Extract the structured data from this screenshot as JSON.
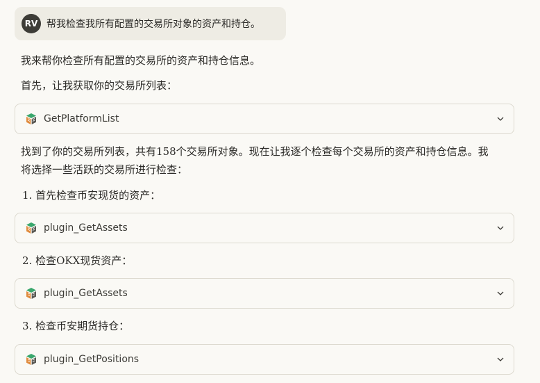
{
  "user_message": {
    "avatar_initials": "RV",
    "text": "帮我检查我所有配置的交易所对象的资产和持仓。"
  },
  "paragraphs": {
    "intro": "我来帮你检查所有配置的交易所的资产和持仓信息。",
    "first": "首先，让我获取你的交易所列表：",
    "found": "找到了你的交易所列表，共有158个交易所对象。现在让我逐个检查每个交易所的资产和持仓信息。我将选择一些活跃的交易所进行检查：",
    "step1": "1. 首先检查币安现货的资产：",
    "step2": "2. 检查OKX现货资产：",
    "step3": "3. 检查币安期货持仓："
  },
  "tools": [
    {
      "name": "GetPlatformList",
      "icon": "cube-stack-icon",
      "expand_icon": "chevron-down-icon"
    },
    {
      "name": "plugin_GetAssets",
      "icon": "cube-stack-icon",
      "expand_icon": "chevron-down-icon"
    },
    {
      "name": "plugin_GetAssets",
      "icon": "cube-stack-icon",
      "expand_icon": "chevron-down-icon"
    },
    {
      "name": "plugin_GetPositions",
      "icon": "cube-stack-icon",
      "expand_icon": "chevron-down-icon"
    }
  ],
  "colors": {
    "background": "#faf9f5",
    "user_bubble": "#eeece4",
    "avatar": "#3d3c37",
    "icon_green": "#3aa76d",
    "icon_orange": "#e08a3c"
  }
}
